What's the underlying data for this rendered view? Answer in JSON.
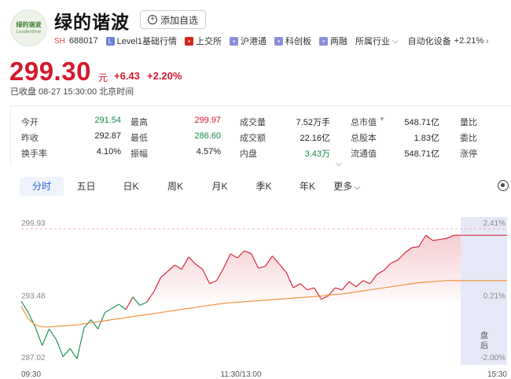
{
  "header": {
    "name": "绿的谐波",
    "add_watch": "添加自选",
    "logo_cn": "绿的谐波",
    "logo_en": "Leaderdrive"
  },
  "tags": {
    "market": "SH",
    "code": "688017",
    "level1": "Level1基础行情",
    "exchange": "上交所",
    "connect": "沪港通",
    "board": "科创板",
    "margin": "两融",
    "industry": "所属行业",
    "sector": "自动化设备",
    "sector_change": "+2.21%"
  },
  "quote": {
    "price": "299.30",
    "unit": "元",
    "change": "+6.43",
    "change_pct": "+2.20%",
    "status": "已收盘 08-27 15:30:00 北京时间"
  },
  "stats": [
    {
      "label": "今开",
      "value": "291.54",
      "tone": "green"
    },
    {
      "label": "最高",
      "value": "299.97",
      "tone": "red"
    },
    {
      "label": "成交量",
      "value": "7.52万手",
      "tone": "plain"
    },
    {
      "label": "总市值",
      "value": "548.71亿",
      "tone": "plain"
    },
    {
      "label": "量比",
      "value": "",
      "tone": "plain"
    },
    {
      "label": "昨收",
      "value": "292.87",
      "tone": "plain"
    },
    {
      "label": "最低",
      "value": "286.60",
      "tone": "green"
    },
    {
      "label": "成交额",
      "value": "22.16亿",
      "tone": "plain"
    },
    {
      "label": "总股本",
      "value": "1.83亿",
      "tone": "plain"
    },
    {
      "label": "委比",
      "value": "",
      "tone": "plain"
    },
    {
      "label": "换手率",
      "value": "4.10%",
      "tone": "plain"
    },
    {
      "label": "振幅",
      "value": "4.57%",
      "tone": "plain"
    },
    {
      "label": "内盘",
      "value": "3.43万",
      "tone": "green"
    },
    {
      "label": "流通值",
      "value": "548.71亿",
      "tone": "plain"
    },
    {
      "label": "涨停",
      "value": "",
      "tone": "plain"
    }
  ],
  "tabs": [
    "分时",
    "五日",
    "日K",
    "周K",
    "月K",
    "季K",
    "年K",
    "更多"
  ],
  "colors": {
    "up": "#d5192d",
    "down": "#11894a",
    "avg": "#f08a2c",
    "accent": "#2466d8"
  },
  "chart_data": {
    "type": "line",
    "x_ticks": [
      "09:30",
      "11:30/13:00",
      "15:30"
    ],
    "y_left_ticks": [
      "299.93",
      "293.48",
      "287.02"
    ],
    "y_right_ticks": [
      "2.41%",
      "0.21%",
      "-2.00%"
    ],
    "ylim": [
      287.02,
      299.93
    ],
    "prev_close": 292.87,
    "after_hours_label": "盘后",
    "series": [
      {
        "role": "price",
        "values": [
          292.9,
          291.8,
          290.4,
          288.6,
          290.2,
          289.2,
          287.5,
          288.3,
          287.3,
          290.3,
          291.1,
          290.2,
          291.8,
          292.2,
          292.6,
          292.1,
          293.3,
          292.5,
          292.8,
          293.8,
          295.2,
          295.8,
          296.4,
          296.0,
          297.2,
          296.5,
          296.0,
          294.6,
          294.9,
          296.1,
          297.5,
          297.1,
          297.8,
          297.5,
          296.1,
          296.3,
          297.3,
          296.5,
          295.7,
          294.2,
          294.6,
          294.0,
          294.2,
          293.1,
          293.4,
          294.2,
          294.0,
          294.8,
          294.3,
          294.9,
          294.6,
          295.5,
          295.9,
          296.6,
          296.9,
          297.6,
          298.1,
          298.2,
          299.3,
          298.8,
          298.9,
          299.0,
          299.3,
          299.3
        ]
      },
      {
        "role": "average",
        "values": [
          292.4,
          291.2,
          290.6,
          290.4,
          290.4,
          290.45,
          290.5,
          290.55,
          290.6,
          290.7,
          290.8,
          290.9,
          291.0,
          291.1,
          291.2,
          291.3,
          291.4,
          291.5,
          291.6,
          291.7,
          291.8,
          291.9,
          292.0,
          292.1,
          292.2,
          292.3,
          292.4,
          292.5,
          292.6,
          292.7,
          292.75,
          292.8,
          292.85,
          292.9,
          292.95,
          293.0,
          293.05,
          293.1,
          293.15,
          293.2,
          293.25,
          293.3,
          293.35,
          293.4,
          293.5,
          293.55,
          293.6,
          293.7,
          293.8,
          293.9,
          294.0,
          294.1,
          294.2,
          294.3,
          294.4,
          294.5,
          294.6,
          294.7,
          294.75,
          294.8,
          294.85,
          294.9,
          294.9,
          294.9
        ]
      }
    ]
  }
}
